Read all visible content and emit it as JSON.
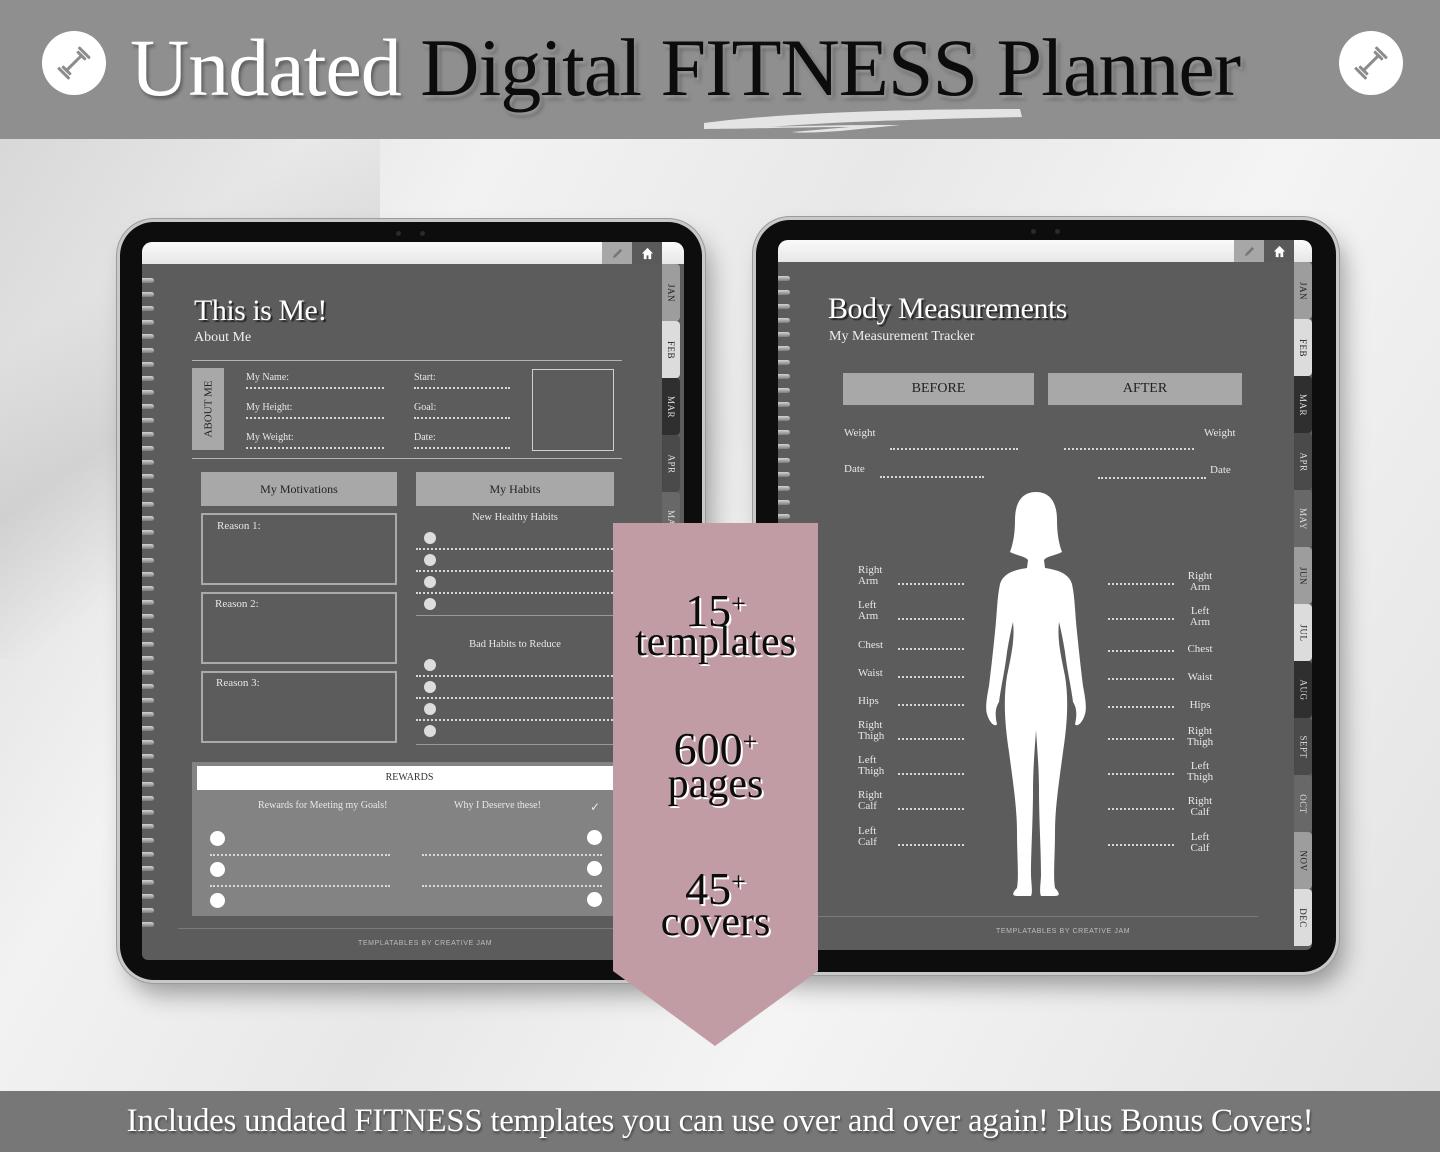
{
  "header": {
    "title_light": "Undated",
    "title_dark": "Digital FITNESS Planner",
    "left_icon": "dumbbell-icon",
    "right_icon": "dumbbell-icon"
  },
  "footer": {
    "tagline": "Includes undated FITNESS templates you can use over and over again! Plus Bonus Covers!"
  },
  "colors": {
    "banner": "#8f8f8f",
    "footer_banner": "#777777",
    "page": "#5c5c5c",
    "pennant": "#c19ca4"
  },
  "pennant": {
    "stats": [
      {
        "number": "15",
        "suffix": "+",
        "label": "templates"
      },
      {
        "number": "600",
        "suffix": "+",
        "label": "pages"
      },
      {
        "number": "45",
        "suffix": "+",
        "label": "covers"
      }
    ]
  },
  "left_tablet": {
    "toolbar": {
      "pencil_icon": "pencil-icon",
      "home_icon": "home-icon"
    },
    "tabs": [
      "JAN",
      "FEB",
      "MAR",
      "APR",
      "MAY"
    ],
    "title": "This is Me!",
    "subtitle": "About Me",
    "about_label": "ABOUT ME",
    "fields_left": [
      "My Name:",
      "My Height:",
      "My Weight:"
    ],
    "fields_right": [
      "Start:",
      "Goal:",
      "Date:"
    ],
    "motivations": {
      "header": "My Motivations",
      "reasons": [
        "Reason 1:",
        "Reason 2:",
        "Reason 3:"
      ]
    },
    "habits": {
      "header": "My Habits",
      "new_label": "New Healthy Habits",
      "bad_label": "Bad Habits to Reduce"
    },
    "rewards": {
      "header": "REWARDS",
      "col1": "Rewards for Meeting my Goals!",
      "col2": "Why I Deserve these!",
      "check": "✓"
    },
    "credit": "Templatables by Creative Jam"
  },
  "right_tablet": {
    "toolbar": {
      "pencil_icon": "pencil-icon",
      "home_icon": "home-icon"
    },
    "tabs": [
      "JAN",
      "FEB",
      "MAR",
      "APR",
      "MAY",
      "JUN",
      "JUL",
      "AUG",
      "SEPT",
      "OCT",
      "NOV",
      "DEC"
    ],
    "title": "Body Measurements",
    "subtitle": "My Measurement Tracker",
    "before_label": "BEFORE",
    "after_label": "AFTER",
    "weight_label": "Weight",
    "date_label": "Date",
    "measurements_left": [
      [
        "Right",
        "Arm"
      ],
      [
        "Left",
        "Arm"
      ],
      [
        "Chest"
      ],
      [
        "Waist"
      ],
      [
        "Hips"
      ],
      [
        "Right",
        "Thigh"
      ],
      [
        "Left",
        "Thigh"
      ],
      [
        "Right",
        "Calf"
      ],
      [
        "Left",
        "Calf"
      ]
    ],
    "measurements_right": [
      [
        "Right",
        "Arm"
      ],
      [
        "Left",
        "Arm"
      ],
      [
        "Chest"
      ],
      [
        "Waist"
      ],
      [
        "Hips"
      ],
      [
        "Right",
        "Thigh"
      ],
      [
        "Left",
        "Thigh"
      ],
      [
        "Right",
        "Calf"
      ],
      [
        "Left",
        "Calf"
      ]
    ],
    "figure": "female-silhouette",
    "credit": "Templatables by Creative Jam"
  }
}
